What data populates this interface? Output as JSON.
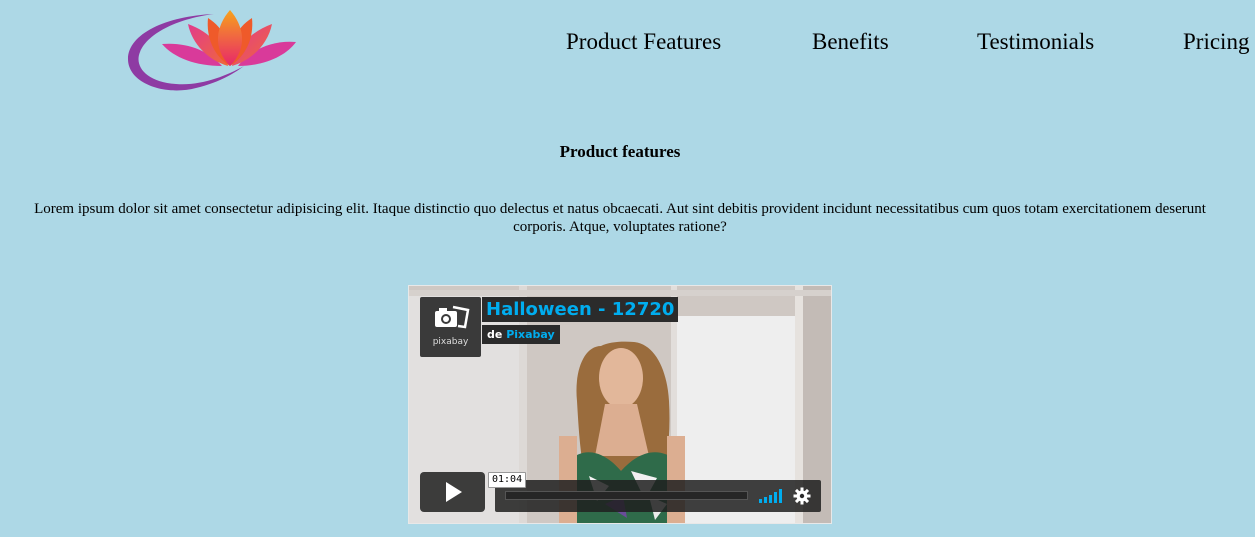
{
  "header": {
    "logo_icon": "lotus-logo-icon",
    "nav": [
      {
        "label": "Product Features"
      },
      {
        "label": "Benefits"
      },
      {
        "label": "Testimonials"
      },
      {
        "label": "Pricing"
      }
    ]
  },
  "section": {
    "title": "Product features",
    "text": "Lorem ipsum dolor sit amet consectetur adipisicing elit. Itaque distinctio quo delectus et natus obcaecati. Aut sint debitis provident incidunt necessitatibus cum quos totam exercitationem deserunt corporis. Atque, voluptates ratione?"
  },
  "video": {
    "title": "Halloween - 12720",
    "by_prefix": "de",
    "author": "Pixabay",
    "badge_label": "pixabay",
    "time": "01:04",
    "accent": "#00adef"
  }
}
